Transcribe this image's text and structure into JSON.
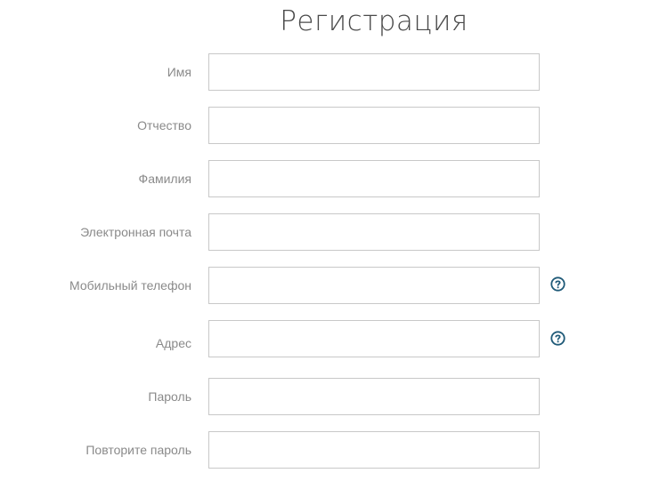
{
  "title": "Регистрация",
  "accent_color": "#1f5a78",
  "fields": [
    {
      "label": "Имя",
      "value": "",
      "help": false
    },
    {
      "label": "Отчество",
      "value": "",
      "help": false
    },
    {
      "label": "Фамилия",
      "value": "",
      "help": false
    },
    {
      "label": "Электронная почта",
      "value": "",
      "help": false
    },
    {
      "label": "Мобильный телефон",
      "value": "",
      "help": true,
      "help_icon": "question-circle-icon"
    },
    {
      "label": "Адрес",
      "value": "",
      "help": true,
      "help_icon": "question-circle-icon"
    },
    {
      "label": "Пароль",
      "value": "",
      "help": false
    },
    {
      "label": "Повторите пароль",
      "value": "",
      "help": false
    }
  ]
}
